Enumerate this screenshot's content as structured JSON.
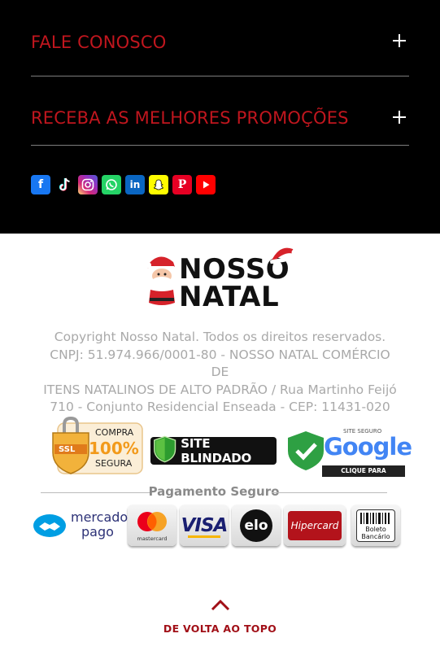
{
  "footer": {
    "accordions": [
      {
        "label": "FALE CONOSCO"
      },
      {
        "label": "RECEBA AS MELHORES PROMOÇÕES"
      }
    ],
    "social": [
      {
        "name": "facebook-icon",
        "color": "#1877f2"
      },
      {
        "name": "tiktok-icon",
        "color": "#000000"
      },
      {
        "name": "instagram-icon",
        "color": "#c13584"
      },
      {
        "name": "whatsapp-icon",
        "color": "#25d366"
      },
      {
        "name": "linkedin-icon",
        "color": "#0a66c2"
      },
      {
        "name": "snapchat-icon",
        "color": "#fffc00"
      },
      {
        "name": "pinterest-icon",
        "color": "#e60023"
      },
      {
        "name": "youtube-icon",
        "color": "#ff0000"
      }
    ],
    "accent_color": "#c0161e"
  },
  "brand": {
    "logo_line1": "NOSSO",
    "logo_line2": "NATAL"
  },
  "legal": {
    "line1": "Copyright Nosso Natal. Todos os direitos reservados.",
    "line2": "CNPJ: 51.974.966/0001-80 - NOSSO NATAL COMÉRCIO DE",
    "line3": "ITENS NATALINOS DE ALTO PADRÃO / Rua Martinho Feijó",
    "line4": "710 - Conjunto Residencial Enseada - CEP: 11431-020"
  },
  "security_badges": {
    "ssl": {
      "line1": "COMPRA",
      "line2": "100%",
      "line3": "SEGURA",
      "tag": "SSL"
    },
    "blindado": {
      "label": "SITE BLINDADO"
    },
    "google": {
      "small": "SITE SEGURO",
      "brand": "Google",
      "cta": "CLIQUE PARA VERIFICAR"
    }
  },
  "payment": {
    "title": "Pagamento Seguro",
    "mercado_pago": {
      "line1": "mercado",
      "line2": "pago"
    },
    "cards": [
      {
        "name": "mastercard",
        "label": "mastercard"
      },
      {
        "name": "visa",
        "label": "VISA"
      },
      {
        "name": "elo",
        "label": "elo"
      },
      {
        "name": "hipercard",
        "label": "Hipercard"
      },
      {
        "name": "boleto",
        "label1": "Boleto",
        "label2": "Bancário"
      }
    ]
  },
  "back_to_top": {
    "label": "DE VOLTA AO TOPO"
  }
}
